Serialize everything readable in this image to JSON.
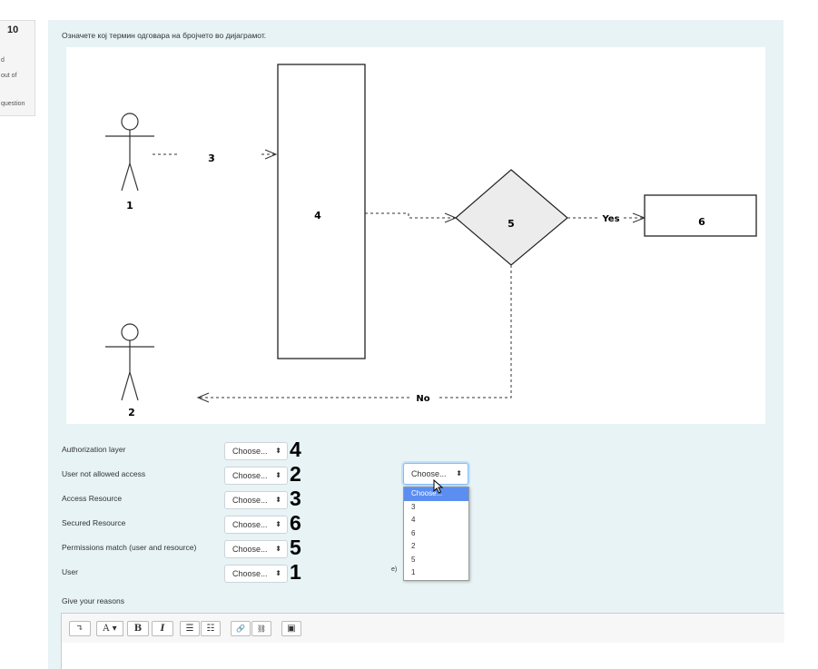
{
  "question_info": {
    "number_fragment": "10",
    "line1": "d",
    "line2": "out of",
    "line3": "question"
  },
  "question": {
    "prompt": "Означете кој термин одговара на бројчето во дијаграмот."
  },
  "diagram": {
    "labels": {
      "actor1": "1",
      "actor2": "2",
      "arrow_label": "3",
      "resource_box": "4",
      "decision": "5",
      "target_box": "6",
      "yes_label": "Yes",
      "no_label": "No"
    }
  },
  "matching": {
    "rows": [
      {
        "label": "Authorization layer",
        "select_value": "Choose...",
        "answer": "4"
      },
      {
        "label": "User not allowed access",
        "select_value": "Choose...",
        "answer": "2"
      },
      {
        "label": "Access Resource",
        "select_value": "Choose...",
        "answer": "3"
      },
      {
        "label": "Secured Resource",
        "select_value": "Choose...",
        "answer": "6"
      },
      {
        "label": "Permissions match (user and resource)",
        "select_value": "Choose...",
        "answer": "5"
      },
      {
        "label": "User",
        "select_value": "Choose...",
        "answer": "1"
      }
    ],
    "select_arrows": "⬍"
  },
  "dropdown": {
    "selected": "Choose...",
    "options": [
      "Choose...",
      "3",
      "4",
      "6",
      "2",
      "5",
      "1"
    ],
    "highlighted_index": 0,
    "behind_fragment": "e)"
  },
  "reasons": {
    "label": "Give your reasons"
  },
  "toolbar": {
    "buttons": [
      {
        "icon": "collapse-icon",
        "glyph": "↴"
      },
      {
        "icon": "font-style-icon",
        "glyph": "A ▾"
      },
      {
        "icon": "bold-icon",
        "glyph": "B"
      },
      {
        "icon": "italic-icon",
        "glyph": "I"
      },
      {
        "icon": "unordered-list-icon",
        "glyph": "☰"
      },
      {
        "icon": "ordered-list-icon",
        "glyph": "☷"
      },
      {
        "icon": "link-icon",
        "glyph": "🔗"
      },
      {
        "icon": "unlink-icon",
        "glyph": "⛓"
      },
      {
        "icon": "image-icon",
        "glyph": "▣"
      }
    ]
  },
  "colors": {
    "panel_bg": "#e7f3f5",
    "highlight": "#5b8ef0",
    "focus_border": "#80bdff"
  }
}
